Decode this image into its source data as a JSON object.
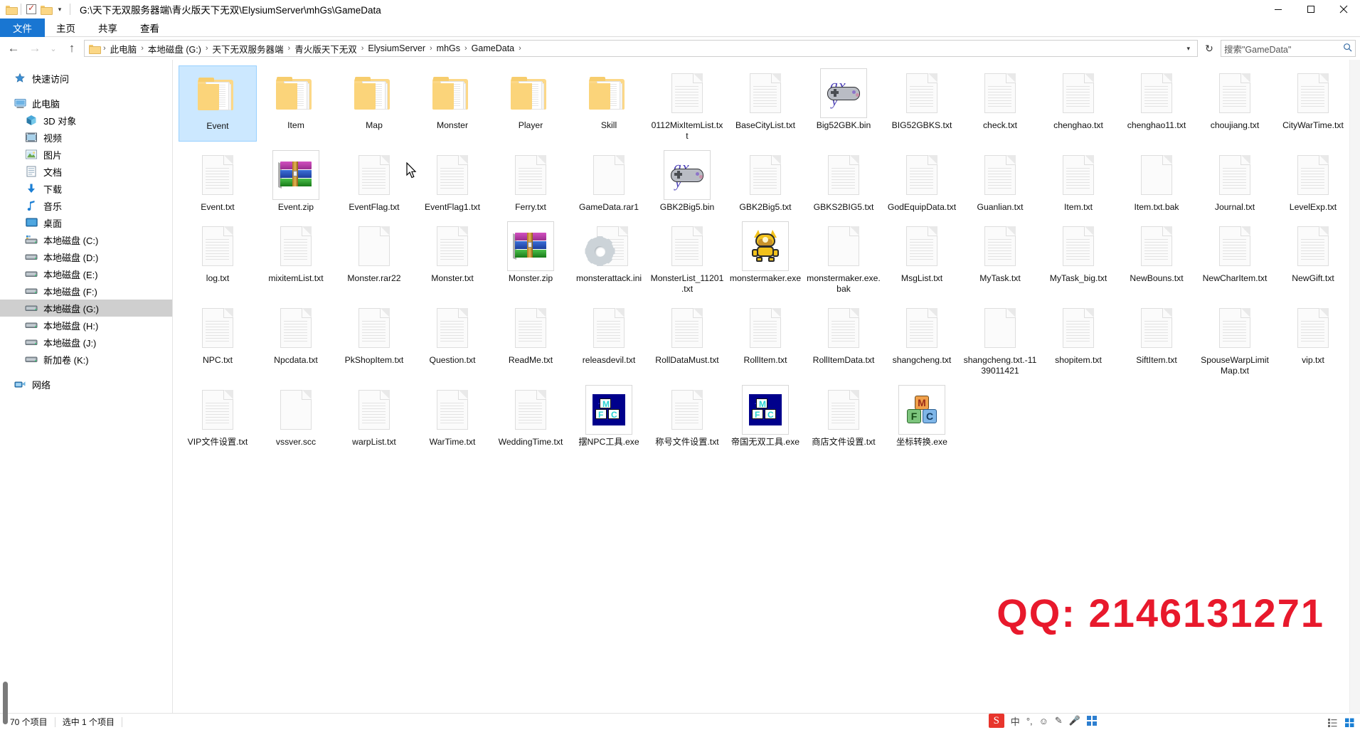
{
  "window": {
    "title": "G:\\天下无双服务器端\\青火版天下无双\\ElysiumServer\\mhGs\\GameData",
    "minimize": "—",
    "maximize": "▢",
    "close": "✕"
  },
  "quick_access_toolbar": {
    "folder_icon": "folder-icon",
    "properties_icon": "properties-icon",
    "dropdown_caret": "▾"
  },
  "ribbon": {
    "tabs": [
      {
        "label": "文件",
        "active": true
      },
      {
        "label": "主页",
        "active": false
      },
      {
        "label": "共享",
        "active": false
      },
      {
        "label": "查看",
        "active": false
      }
    ]
  },
  "address_bar": {
    "back": "←",
    "forward": "→",
    "recent": "⌄",
    "up": "↑",
    "refresh": "↻",
    "dropdown": "▾",
    "breadcrumbs": [
      "此电脑",
      "本地磁盘 (G:)",
      "天下无双服务器端",
      "青火版天下无双",
      "ElysiumServer",
      "mhGs",
      "GameData"
    ],
    "separator": "›",
    "search_value": "搜索\"GameData\"",
    "search_icon": "search-icon"
  },
  "sidebar": {
    "items": [
      {
        "label": "快速访问",
        "icon": "star-icon",
        "indent": false,
        "selected": false
      },
      {
        "label": "此电脑",
        "icon": "computer-icon",
        "indent": false,
        "selected": false
      },
      {
        "label": "3D 对象",
        "icon": "3d-objects-icon",
        "indent": true,
        "selected": false
      },
      {
        "label": "视频",
        "icon": "videos-icon",
        "indent": true,
        "selected": false
      },
      {
        "label": "图片",
        "icon": "pictures-icon",
        "indent": true,
        "selected": false
      },
      {
        "label": "文档",
        "icon": "documents-icon",
        "indent": true,
        "selected": false
      },
      {
        "label": "下载",
        "icon": "downloads-icon",
        "indent": true,
        "selected": false
      },
      {
        "label": "音乐",
        "icon": "music-icon",
        "indent": true,
        "selected": false
      },
      {
        "label": "桌面",
        "icon": "desktop-icon",
        "indent": true,
        "selected": false
      },
      {
        "label": "本地磁盘 (C:)",
        "icon": "system-drive-icon",
        "indent": true,
        "selected": false
      },
      {
        "label": "本地磁盘 (D:)",
        "icon": "drive-icon",
        "indent": true,
        "selected": false
      },
      {
        "label": "本地磁盘 (E:)",
        "icon": "drive-icon",
        "indent": true,
        "selected": false
      },
      {
        "label": "本地磁盘 (F:)",
        "icon": "drive-icon",
        "indent": true,
        "selected": false
      },
      {
        "label": "本地磁盘 (G:)",
        "icon": "drive-icon",
        "indent": true,
        "selected": true
      },
      {
        "label": "本地磁盘 (H:)",
        "icon": "drive-icon",
        "indent": true,
        "selected": false
      },
      {
        "label": "本地磁盘 (J:)",
        "icon": "drive-icon",
        "indent": true,
        "selected": false
      },
      {
        "label": "新加卷 (K:)",
        "icon": "drive-icon",
        "indent": true,
        "selected": false
      },
      {
        "label": "网络",
        "icon": "network-icon",
        "indent": false,
        "selected": false
      }
    ]
  },
  "files": [
    {
      "name": "Event",
      "type": "folder",
      "selected": true
    },
    {
      "name": "Item",
      "type": "folder",
      "selected": false
    },
    {
      "name": "Map",
      "type": "folder",
      "selected": false
    },
    {
      "name": "Monster",
      "type": "folder",
      "selected": false
    },
    {
      "name": "Player",
      "type": "folder",
      "selected": false
    },
    {
      "name": "Skill",
      "type": "folder",
      "selected": false
    },
    {
      "name": "0112MixItemList.txt",
      "type": "text",
      "selected": false
    },
    {
      "name": "BaseCityList.txt",
      "type": "text",
      "selected": false
    },
    {
      "name": "Big52GBK.bin",
      "type": "bin",
      "selected": false
    },
    {
      "name": "BIG52GBKS.txt",
      "type": "text",
      "selected": false
    },
    {
      "name": "check.txt",
      "type": "text",
      "selected": false
    },
    {
      "name": "chenghao.txt",
      "type": "text",
      "selected": false
    },
    {
      "name": "chenghao11.txt",
      "type": "text",
      "selected": false
    },
    {
      "name": "choujiang.txt",
      "type": "text",
      "selected": false
    },
    {
      "name": "CityWarTime.txt",
      "type": "text",
      "selected": false
    },
    {
      "name": "Event.txt",
      "type": "text",
      "selected": false
    },
    {
      "name": "Event.zip",
      "type": "archive",
      "selected": false
    },
    {
      "name": "EventFlag.txt",
      "type": "text",
      "selected": false
    },
    {
      "name": "EventFlag1.txt",
      "type": "text",
      "selected": false
    },
    {
      "name": "Ferry.txt",
      "type": "text",
      "selected": false
    },
    {
      "name": "GameData.rar1",
      "type": "blank",
      "selected": false
    },
    {
      "name": "GBK2Big5.bin",
      "type": "bin",
      "selected": false
    },
    {
      "name": "GBK2Big5.txt",
      "type": "text",
      "selected": false
    },
    {
      "name": "GBKS2BIG5.txt",
      "type": "text",
      "selected": false
    },
    {
      "name": "GodEquipData.txt",
      "type": "text",
      "selected": false
    },
    {
      "name": "Guanlian.txt",
      "type": "text",
      "selected": false
    },
    {
      "name": "Item.txt",
      "type": "text",
      "selected": false
    },
    {
      "name": "Item.txt.bak",
      "type": "blank",
      "selected": false
    },
    {
      "name": "Journal.txt",
      "type": "text",
      "selected": false
    },
    {
      "name": "LevelExp.txt",
      "type": "text",
      "selected": false
    },
    {
      "name": "log.txt",
      "type": "text",
      "selected": false
    },
    {
      "name": "mixitemList.txt",
      "type": "text",
      "selected": false
    },
    {
      "name": "Monster.rar22",
      "type": "blank",
      "selected": false
    },
    {
      "name": "Monster.txt",
      "type": "text",
      "selected": false
    },
    {
      "name": "Monster.zip",
      "type": "archive",
      "selected": false
    },
    {
      "name": "monsterattack.ini",
      "type": "ini",
      "selected": false
    },
    {
      "name": "MonsterList_11201.txt",
      "type": "text",
      "selected": false
    },
    {
      "name": "monstermaker.exe",
      "type": "monster-exe",
      "selected": false
    },
    {
      "name": "monstermaker.exe.bak",
      "type": "blank",
      "selected": false
    },
    {
      "name": "MsgList.txt",
      "type": "text",
      "selected": false
    },
    {
      "name": "MyTask.txt",
      "type": "text",
      "selected": false
    },
    {
      "name": "MyTask_big.txt",
      "type": "text",
      "selected": false
    },
    {
      "name": "NewBouns.txt",
      "type": "text",
      "selected": false
    },
    {
      "name": "NewCharItem.txt",
      "type": "text",
      "selected": false
    },
    {
      "name": "NewGift.txt",
      "type": "text",
      "selected": false
    },
    {
      "name": "NPC.txt",
      "type": "text",
      "selected": false
    },
    {
      "name": "Npcdata.txt",
      "type": "text",
      "selected": false
    },
    {
      "name": "PkShopItem.txt",
      "type": "text",
      "selected": false
    },
    {
      "name": "Question.txt",
      "type": "text",
      "selected": false
    },
    {
      "name": "ReadMe.txt",
      "type": "text",
      "selected": false
    },
    {
      "name": "releasdevil.txt",
      "type": "text",
      "selected": false
    },
    {
      "name": "RollDataMust.txt",
      "type": "text",
      "selected": false
    },
    {
      "name": "RollItem.txt",
      "type": "text",
      "selected": false
    },
    {
      "name": "RollItemData.txt",
      "type": "text",
      "selected": false
    },
    {
      "name": "shangcheng.txt",
      "type": "text",
      "selected": false
    },
    {
      "name": "shangcheng.txt.-1139011421",
      "type": "blank",
      "selected": false
    },
    {
      "name": "shopitem.txt",
      "type": "text",
      "selected": false
    },
    {
      "name": "SiftItem.txt",
      "type": "text",
      "selected": false
    },
    {
      "name": "SpouseWarpLimitMap.txt",
      "type": "text",
      "selected": false
    },
    {
      "name": "vip.txt",
      "type": "text",
      "selected": false
    },
    {
      "name": "VIP文件设置.txt",
      "type": "text",
      "selected": false
    },
    {
      "name": "vssver.scc",
      "type": "blank",
      "selected": false
    },
    {
      "name": "warpList.txt",
      "type": "text",
      "selected": false
    },
    {
      "name": "WarTime.txt",
      "type": "text",
      "selected": false
    },
    {
      "name": "WeddingTime.txt",
      "type": "text",
      "selected": false
    },
    {
      "name": "摆NPC工具.exe",
      "type": "mfc-exe",
      "selected": false
    },
    {
      "name": "称号文件设置.txt",
      "type": "text",
      "selected": false
    },
    {
      "name": "帝国无双工具.exe",
      "type": "mfc-exe",
      "selected": false
    },
    {
      "name": "商店文件设置.txt",
      "type": "text",
      "selected": false
    },
    {
      "name": "坐标转换.exe",
      "type": "mfc-color-exe",
      "selected": false
    }
  ],
  "status_bar": {
    "item_count": "70 个项目",
    "selection": "选中 1 个项目",
    "view_icons": [
      "details-view-icon",
      "large-icons-view-icon"
    ]
  },
  "ime_bar": {
    "logo": "S",
    "mode": "中",
    "punctuation": "°,",
    "emoji_icon": "emoji-icon",
    "pen_icon": "pen-icon",
    "mic_icon": "mic-icon",
    "toolbox_icon": "toolbox-icon"
  },
  "watermark": {
    "text": "QQ: 2146131271",
    "color": "#e8192c"
  }
}
